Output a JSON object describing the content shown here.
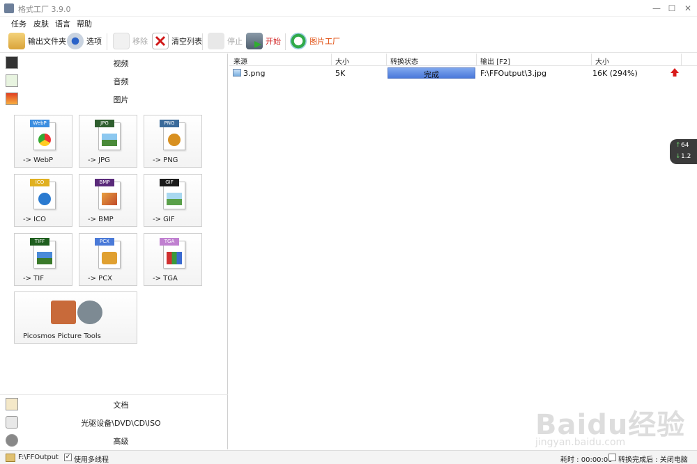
{
  "window": {
    "title": "格式工厂 3.9.0",
    "min": "—",
    "max": "☐",
    "close": "✕"
  },
  "menu": [
    "任务",
    "皮肤",
    "语言",
    "帮助"
  ],
  "toolbar": {
    "output_folder": "输出文件夹",
    "options": "选项",
    "remove": "移除",
    "clear_list": "清空列表",
    "stop": "停止",
    "start": "开始",
    "picture_factory": "图片工厂"
  },
  "categories": {
    "video": "视频",
    "audio": "音频",
    "picture": "图片",
    "document": "文档",
    "optical": "光驱设备\\DVD\\CD\\ISO",
    "advanced": "高级"
  },
  "tiles": [
    {
      "label": "-> WebP",
      "tag": "WebP",
      "tag_color": "#3c8ee0"
    },
    {
      "label": "-> JPG",
      "tag": "JPG",
      "tag_color": "#2f5f2f"
    },
    {
      "label": "-> PNG",
      "tag": "PNG",
      "tag_color": "#3a6a9a"
    },
    {
      "label": "-> ICO",
      "tag": "ICO",
      "tag_color": "#e0b020"
    },
    {
      "label": "-> BMP",
      "tag": "BMP",
      "tag_color": "#5a2a7a"
    },
    {
      "label": "-> GIF",
      "tag": "GIF",
      "tag_color": "#1a1a1a"
    },
    {
      "label": "-> TIF",
      "tag": "TIFF",
      "tag_color": "#1f5f1f"
    },
    {
      "label": "-> PCX",
      "tag": "PCX",
      "tag_color": "#4a7ad8"
    },
    {
      "label": "-> TGA",
      "tag": "TGA",
      "tag_color": "#c080d0"
    }
  ],
  "big_tile": {
    "label": "Picosmos Picture Tools"
  },
  "list": {
    "headers": {
      "source": "来源",
      "size": "大小",
      "status": "转换状态",
      "output": "输出 [F2]",
      "out_size": "大小"
    },
    "rows": [
      {
        "source": "3.png",
        "size": "5K",
        "status": "完成",
        "progress": 1.0,
        "output": "F:\\FFOutput\\3.jpg",
        "out_size": "16K  (294%)"
      }
    ]
  },
  "net": {
    "up": "64",
    "down": "1.2"
  },
  "status": {
    "output_path": "F:\\FFOutput",
    "multithread": "使用多线程",
    "elapsed": "耗时 : 00:00:00",
    "after": "转换完成后 : 关闭电脑"
  },
  "watermark": {
    "big": "Baidu经验",
    "small": "jingyan.baidu.com"
  }
}
